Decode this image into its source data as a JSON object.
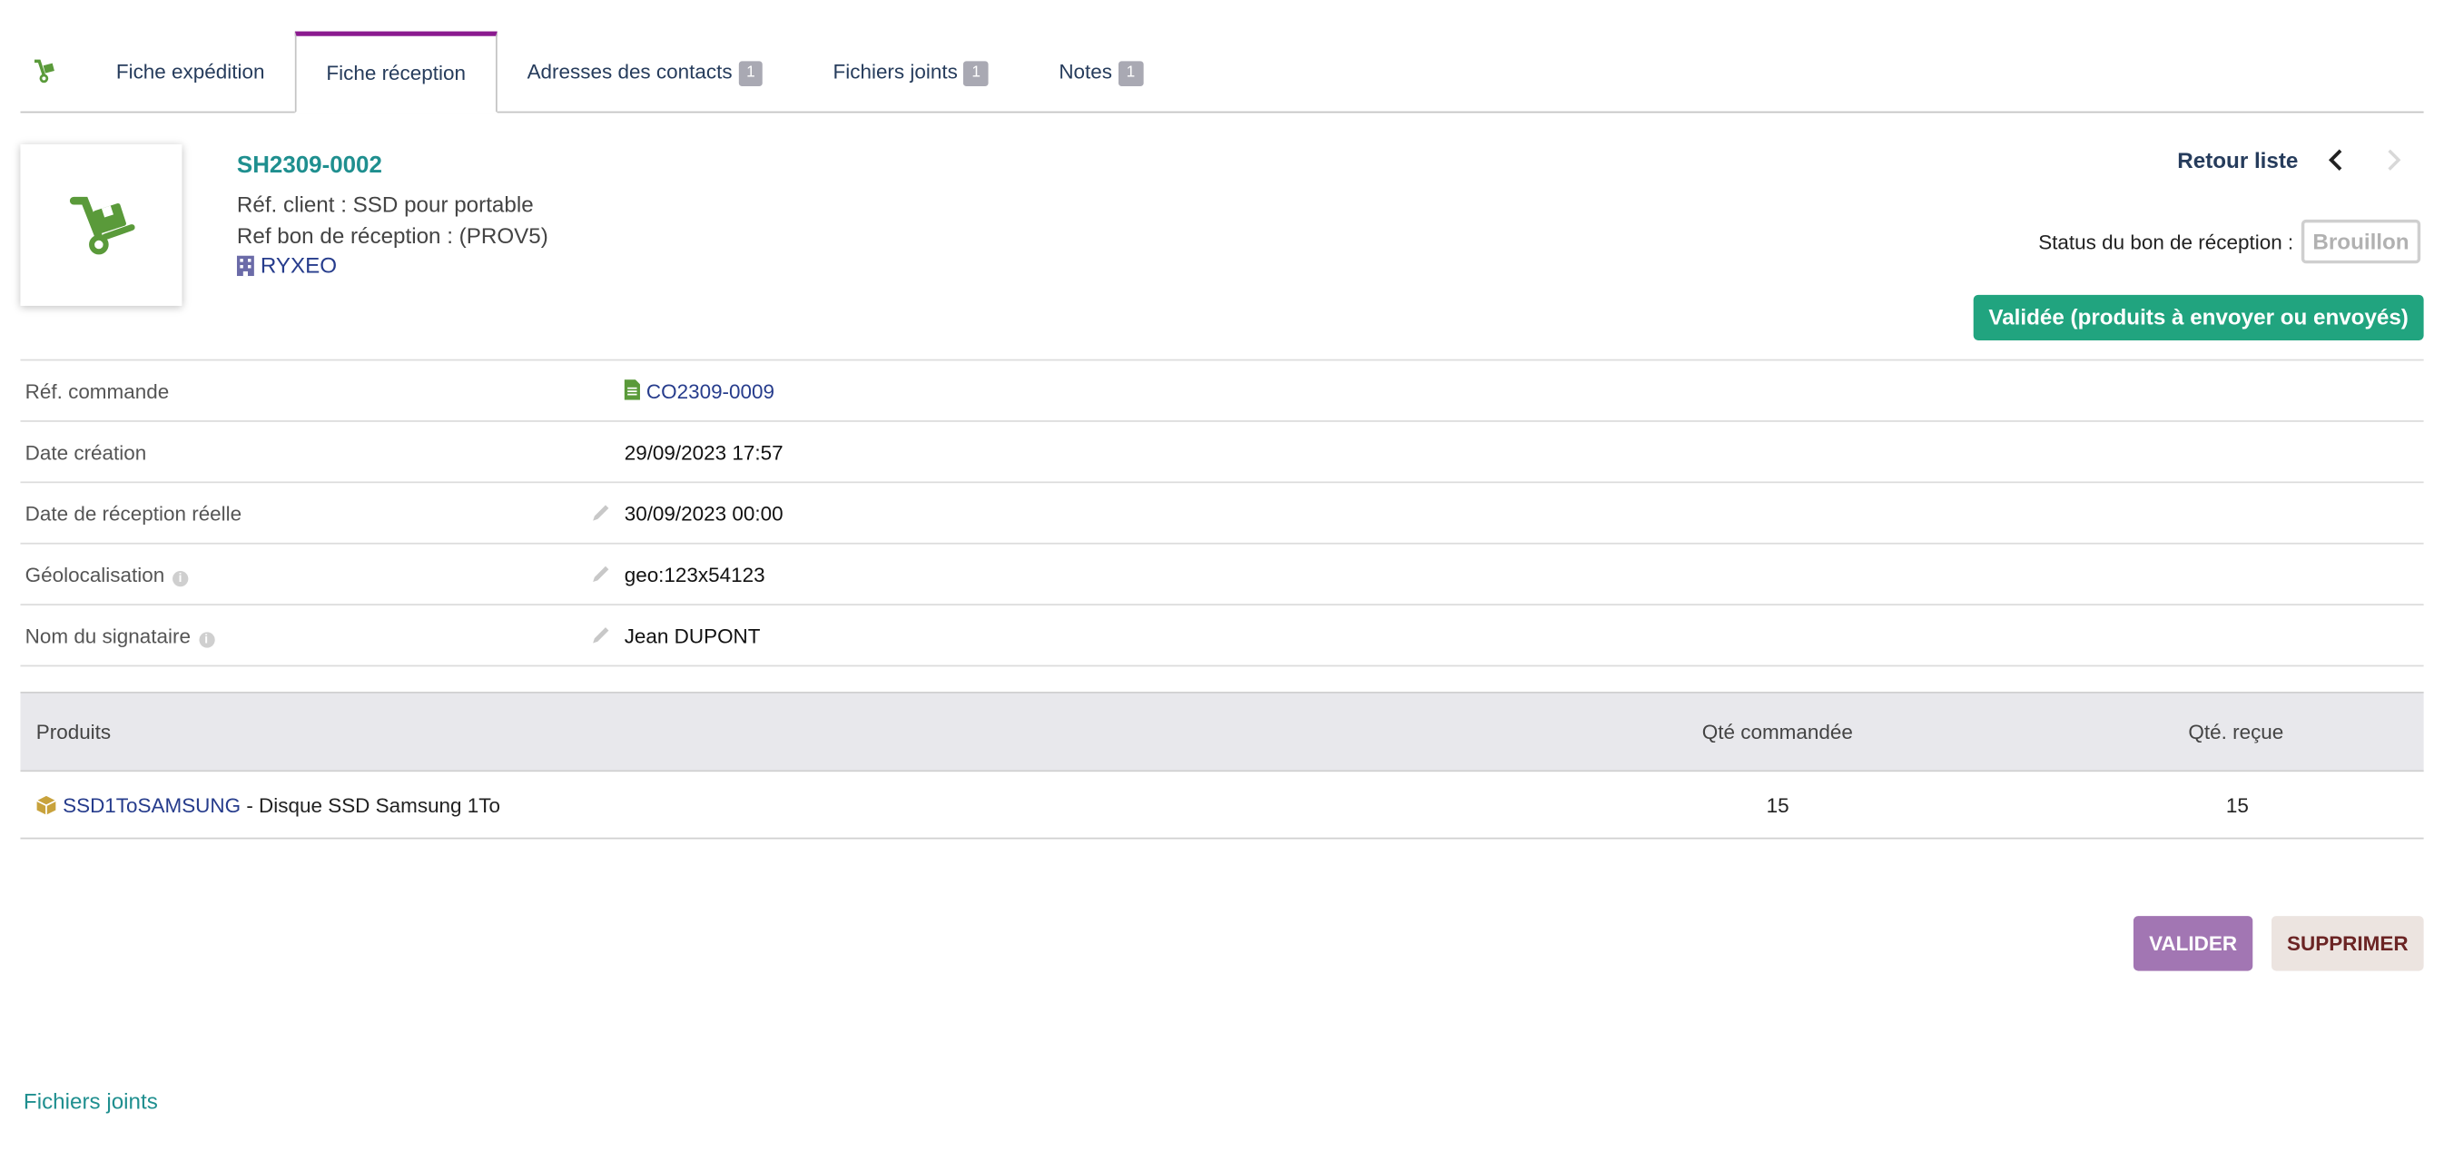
{
  "tabs": [
    {
      "label": "Fiche expédition",
      "badge": null
    },
    {
      "label": "Fiche réception",
      "badge": null,
      "active": true
    },
    {
      "label": "Adresses des contacts",
      "badge": "1"
    },
    {
      "label": "Fichiers joints",
      "badge": "1"
    },
    {
      "label": "Notes",
      "badge": "1"
    }
  ],
  "header": {
    "reference": "SH2309-0002",
    "client_ref": "Réf. client : SSD pour portable",
    "reception_ref": "Ref bon de réception : (PROV5)",
    "company": "RYXEO",
    "back_label": "Retour liste",
    "status_label": "Status du bon de réception :",
    "status_draft": "Brouillon",
    "status_validated": "Validée (produits à envoyer ou envoyés)",
    "accent_color": "#21a47f"
  },
  "fields": [
    {
      "label": "Réf. commande",
      "value": "CO2309-0009"
    },
    {
      "label": "Date création",
      "value": "29/09/2023 17:57"
    },
    {
      "label": "Date de réception réelle",
      "value": "30/09/2023 00:00"
    },
    {
      "label": "Géolocalisation",
      "value": "geo:123x54123"
    },
    {
      "label": "Nom du signataire",
      "value": "Jean DUPONT"
    }
  ],
  "products": {
    "headers": {
      "product": "Produits",
      "qty_ordered": "Qté commandée",
      "qty_received": "Qté. reçue"
    },
    "rows": [
      {
        "code": "SSD1ToSAMSUNG",
        "description": " - Disque SSD Samsung 1To",
        "qty_ordered": "15",
        "qty_received": "15"
      }
    ]
  },
  "actions": {
    "validate": "VALIDER",
    "delete": "SUPPRIMER"
  },
  "files_link": "Fichiers joints"
}
